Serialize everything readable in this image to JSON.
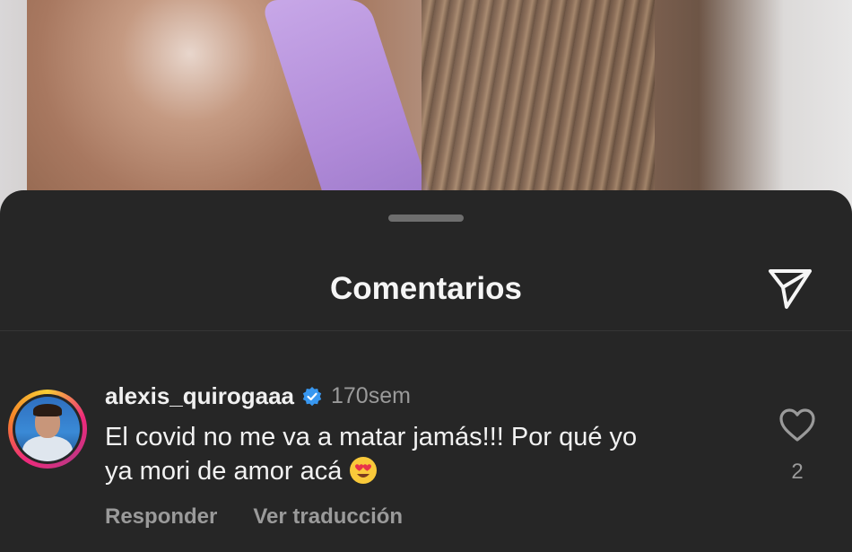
{
  "sheet": {
    "title": "Comentarios"
  },
  "icons": {
    "share": "paper-plane-icon",
    "verified": "verified-badge-icon",
    "like": "heart-outline-icon",
    "emoji": "heart-eyes-emoji"
  },
  "comment": {
    "username": "alexis_quirogaaa",
    "time": "170sem",
    "text_line1": "El covid no me va a matar jamás!!! Por qué yo",
    "text_line2": "ya mori de amor acá",
    "likes": "2",
    "reply_label": "Responder",
    "translate_label": "Ver traducción"
  },
  "colors": {
    "sheet_bg": "#262626",
    "verified_blue": "#3897f0",
    "muted_text": "#9a9a9a"
  }
}
